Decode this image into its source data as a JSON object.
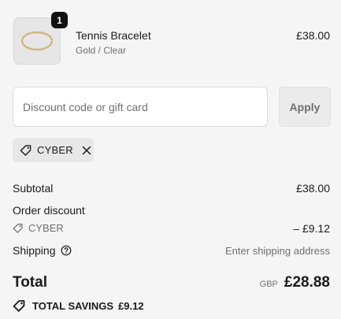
{
  "line_item": {
    "quantity": "1",
    "name": "Tennis Bracelet",
    "variant": "Gold / Clear",
    "price": "£38.00",
    "image_icon": "bracelet-image"
  },
  "discount": {
    "placeholder": "Discount code or gift card",
    "value": "",
    "apply_label": "Apply"
  },
  "applied_code": {
    "code": "CYBER",
    "icon": "tag-icon",
    "remove_icon": "close-icon"
  },
  "summary": {
    "subtotal_label": "Subtotal",
    "subtotal_value": "£38.00",
    "order_discount_label": "Order discount",
    "discount_code": "CYBER",
    "discount_value": "– £9.12",
    "shipping_label": "Shipping",
    "shipping_value": "Enter shipping address",
    "total_label": "Total",
    "currency": "GBP",
    "total_value": "£28.88",
    "savings_label": "TOTAL SAVINGS",
    "savings_value": "£9.12"
  },
  "colors": {
    "background": "#f5f5f5",
    "text": "#1a1a1a",
    "muted": "#707070",
    "chip_bg": "#e7e7e7"
  }
}
